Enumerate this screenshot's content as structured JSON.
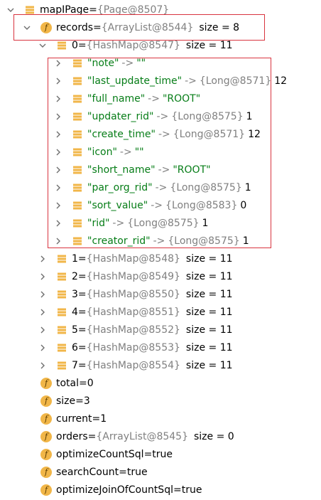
{
  "root": {
    "name": "mapIPage",
    "ref": "{Page@8507}"
  },
  "records": {
    "name": "records",
    "ref": "{ArrayList@8544}",
    "size": "size = 8"
  },
  "item0": {
    "index": "0",
    "ref": "{HashMap@8547}",
    "size": "size = 11"
  },
  "entries": [
    {
      "key": "\"note\"",
      "ref": "",
      "value": "\"\"",
      "value_type": "str"
    },
    {
      "key": "\"last_update_time\"",
      "ref": "{Long@8571}",
      "value": "12",
      "value_type": "num"
    },
    {
      "key": "\"full_name\"",
      "ref": "",
      "value": "\"ROOT\"",
      "value_type": "str"
    },
    {
      "key": "\"updater_rid\"",
      "ref": "{Long@8575}",
      "value": "1",
      "value_type": "num"
    },
    {
      "key": "\"create_time\"",
      "ref": "{Long@8571}",
      "value": "12",
      "value_type": "num"
    },
    {
      "key": "\"icon\"",
      "ref": "",
      "value": "\"\"",
      "value_type": "str"
    },
    {
      "key": "\"short_name\"",
      "ref": "",
      "value": "\"ROOT\"",
      "value_type": "str"
    },
    {
      "key": "\"par_org_rid\"",
      "ref": "{Long@8575}",
      "value": "1",
      "value_type": "num"
    },
    {
      "key": "\"sort_value\"",
      "ref": "{Long@8583}",
      "value": "0",
      "value_type": "num"
    },
    {
      "key": "\"rid\"",
      "ref": "{Long@8575}",
      "value": "1",
      "value_type": "num"
    },
    {
      "key": "\"creator_rid\"",
      "ref": "{Long@8575}",
      "value": "1",
      "value_type": "num"
    }
  ],
  "arrow": "->",
  "items": [
    {
      "index": "1",
      "ref": "{HashMap@8548}",
      "size": "size = 11"
    },
    {
      "index": "2",
      "ref": "{HashMap@8549}",
      "size": "size = 11"
    },
    {
      "index": "3",
      "ref": "{HashMap@8550}",
      "size": "size = 11"
    },
    {
      "index": "4",
      "ref": "{HashMap@8551}",
      "size": "size = 11"
    },
    {
      "index": "5",
      "ref": "{HashMap@8552}",
      "size": "size = 11"
    },
    {
      "index": "6",
      "ref": "{HashMap@8553}",
      "size": "size = 11"
    },
    {
      "index": "7",
      "ref": "{HashMap@8554}",
      "size": "size = 11"
    }
  ],
  "fields": [
    {
      "name": "total",
      "value": "0",
      "ref": "",
      "size": ""
    },
    {
      "name": "size",
      "value": "3",
      "ref": "",
      "size": ""
    },
    {
      "name": "current",
      "value": "1",
      "ref": "",
      "size": ""
    },
    {
      "name": "orders",
      "value": "",
      "ref": "{ArrayList@8545}",
      "size": "size = 0"
    },
    {
      "name": "optimizeCountSql",
      "value": "true",
      "ref": "",
      "size": ""
    },
    {
      "name": "searchCount",
      "value": "true",
      "ref": "",
      "size": ""
    },
    {
      "name": "optimizeJoinOfCountSql",
      "value": "true",
      "ref": "",
      "size": ""
    }
  ],
  "field_icon_letter": "f",
  "eq": "=",
  "colors": {
    "highlight_border": "#d9343f",
    "field_icon": "#f1b648",
    "list_icon": "#f1b648",
    "string_value": "#067d17",
    "reference": "#808080"
  },
  "icons": {
    "expanded": "chevron-down-icon",
    "collapsed": "chevron-right-icon",
    "object": "list-icon",
    "field": "field-icon"
  }
}
